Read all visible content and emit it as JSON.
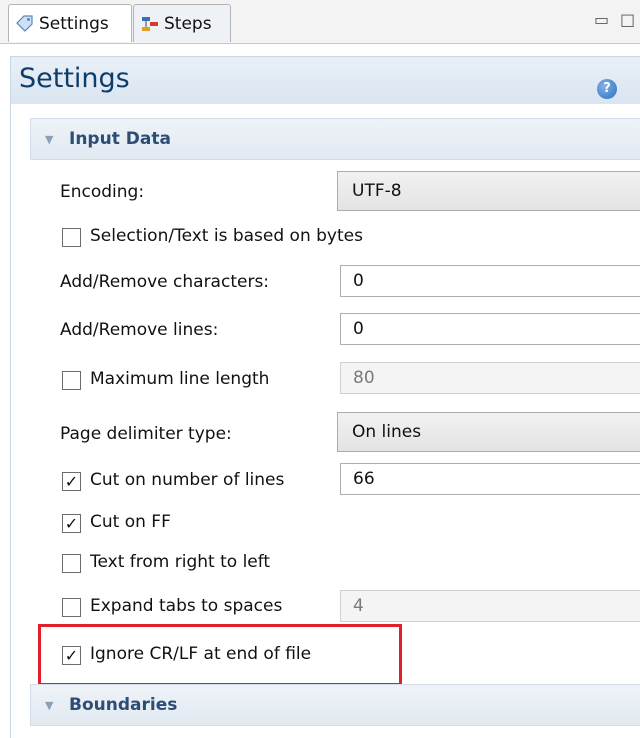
{
  "tabs": [
    {
      "label": "Settings",
      "icon": "tag-icon"
    },
    {
      "label": "Steps",
      "icon": "steps-icon"
    }
  ],
  "window_controls": {
    "minimize": "▭",
    "maximize": "□"
  },
  "header": {
    "title": "Settings",
    "help_icon": "?"
  },
  "sections": {
    "input_data": {
      "label": "Input Data"
    },
    "boundaries": {
      "label": "Boundaries"
    }
  },
  "input_data": {
    "encoding_label": "Encoding:",
    "encoding_value": "UTF-8",
    "selection_bytes_label": "Selection/Text is based on bytes",
    "add_remove_chars_label": "Add/Remove characters:",
    "add_remove_chars_value": "0",
    "add_remove_lines_label": "Add/Remove lines:",
    "add_remove_lines_value": "0",
    "max_line_length_label": "Maximum line length",
    "max_line_length_value": "80",
    "page_delimiter_label": "Page delimiter type:",
    "page_delimiter_value": "On lines",
    "cut_lines_label": "Cut on number of lines",
    "cut_lines_value": "66",
    "cut_ff_label": "Cut on FF",
    "rtl_label": "Text from right to left",
    "expand_tabs_label": "Expand tabs to spaces",
    "expand_tabs_value": "4",
    "ignore_crlf_label": "Ignore CR/LF at end of file"
  },
  "checkbox_states": {
    "selection_bytes": false,
    "max_line_length": false,
    "cut_lines": true,
    "cut_ff": true,
    "rtl": false,
    "expand_tabs": false,
    "ignore_crlf": true
  },
  "colors": {
    "highlight": "#e0202a",
    "section_text": "#2c4d74",
    "title": "#0f3d6a"
  }
}
